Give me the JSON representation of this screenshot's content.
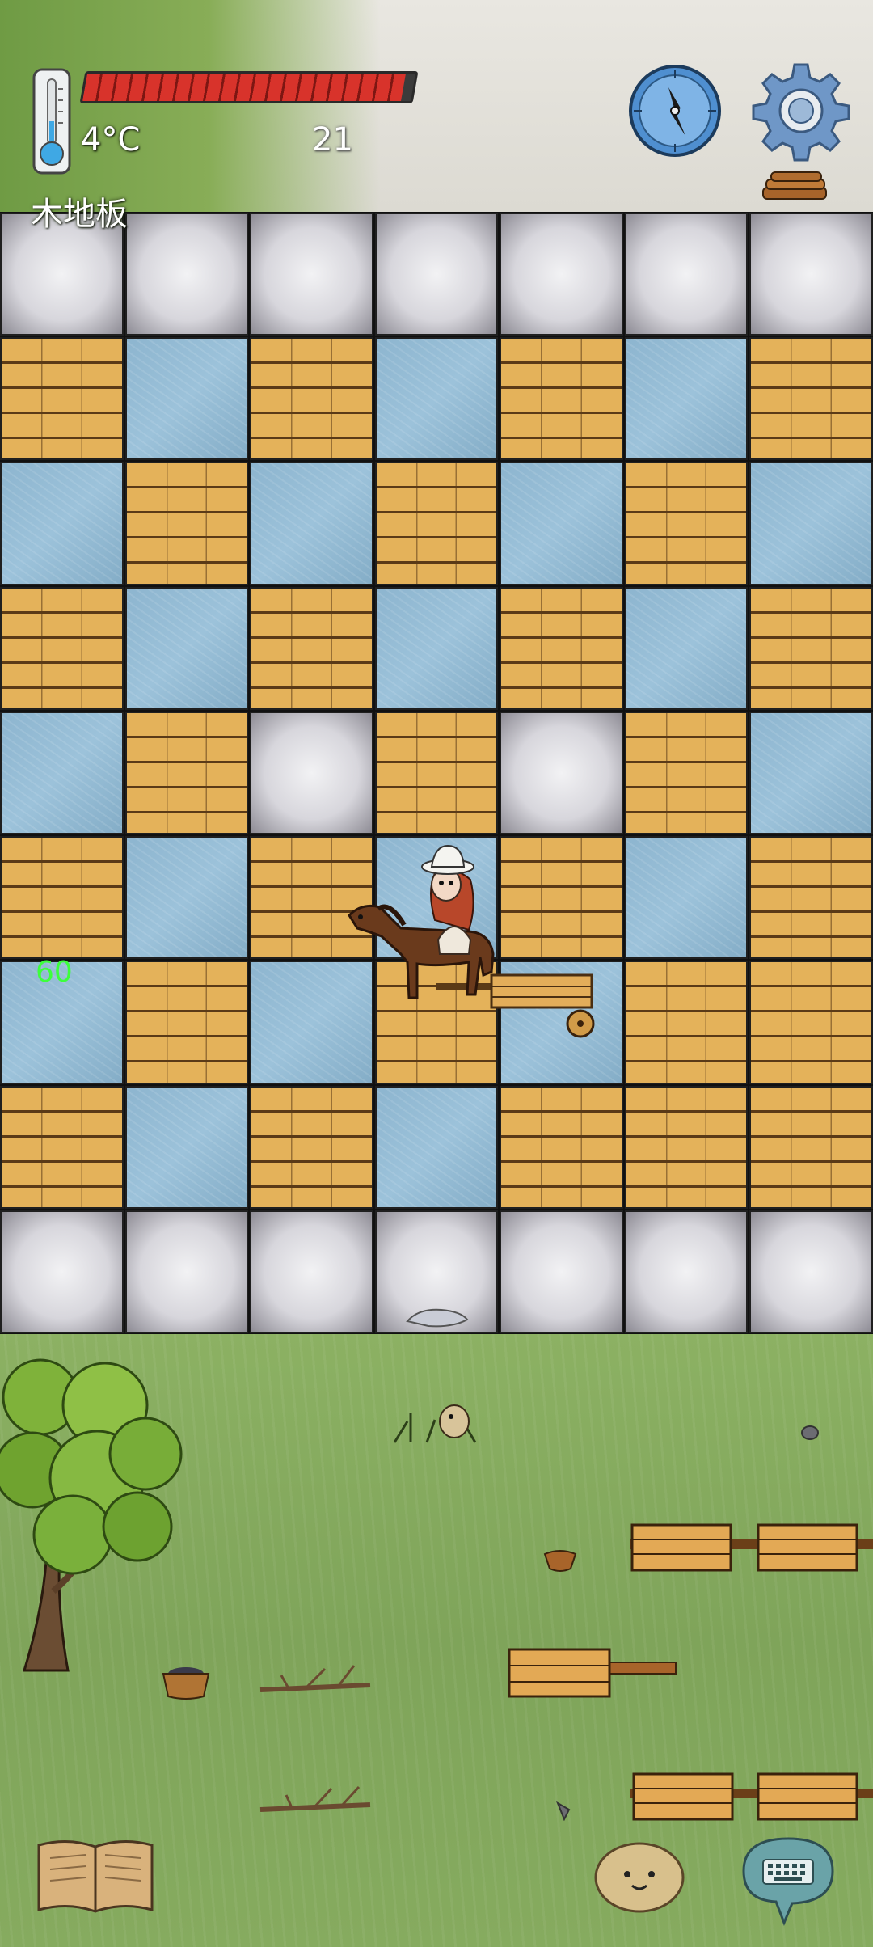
{
  "hud": {
    "temperature": "4°C",
    "day_count": "21",
    "terrain_name": "木地板",
    "health_fraction": 0.97
  },
  "board": {
    "columns": 7,
    "rows": [
      [
        "stone",
        "stone",
        "stone",
        "stone",
        "stone",
        "stone",
        "stone"
      ],
      [
        "wood",
        "water",
        "wood",
        "water",
        "wood",
        "water",
        "wood"
      ],
      [
        "water",
        "wood",
        "water",
        "wood",
        "water",
        "wood",
        "water"
      ],
      [
        "wood",
        "water",
        "wood",
        "water",
        "wood",
        "water",
        "wood"
      ],
      [
        "water",
        "wood",
        "stone",
        "wood",
        "stone",
        "wood",
        "water"
      ],
      [
        "wood",
        "water",
        "wood",
        "water",
        "wood",
        "water",
        "wood"
      ],
      [
        "water",
        "wood",
        "water",
        "wood",
        "water",
        "wood",
        "wood"
      ],
      [
        "wood",
        "water",
        "wood",
        "water",
        "wood",
        "wood",
        "wood"
      ],
      [
        "stone",
        "stone",
        "stone",
        "stone",
        "stone",
        "stone",
        "stone"
      ]
    ],
    "cell_label": "60"
  },
  "icons": {
    "thermometer": "thermometer-icon",
    "compass": "compass-icon",
    "settings": "gear-icon",
    "journal": "open-book-icon",
    "emote": "smiley-potato-icon",
    "keyboard": "keyboard-chat-icon"
  },
  "colors": {
    "health": "#d8332b",
    "label_green": "#3cff3c",
    "compass": "#4f8fd0"
  }
}
